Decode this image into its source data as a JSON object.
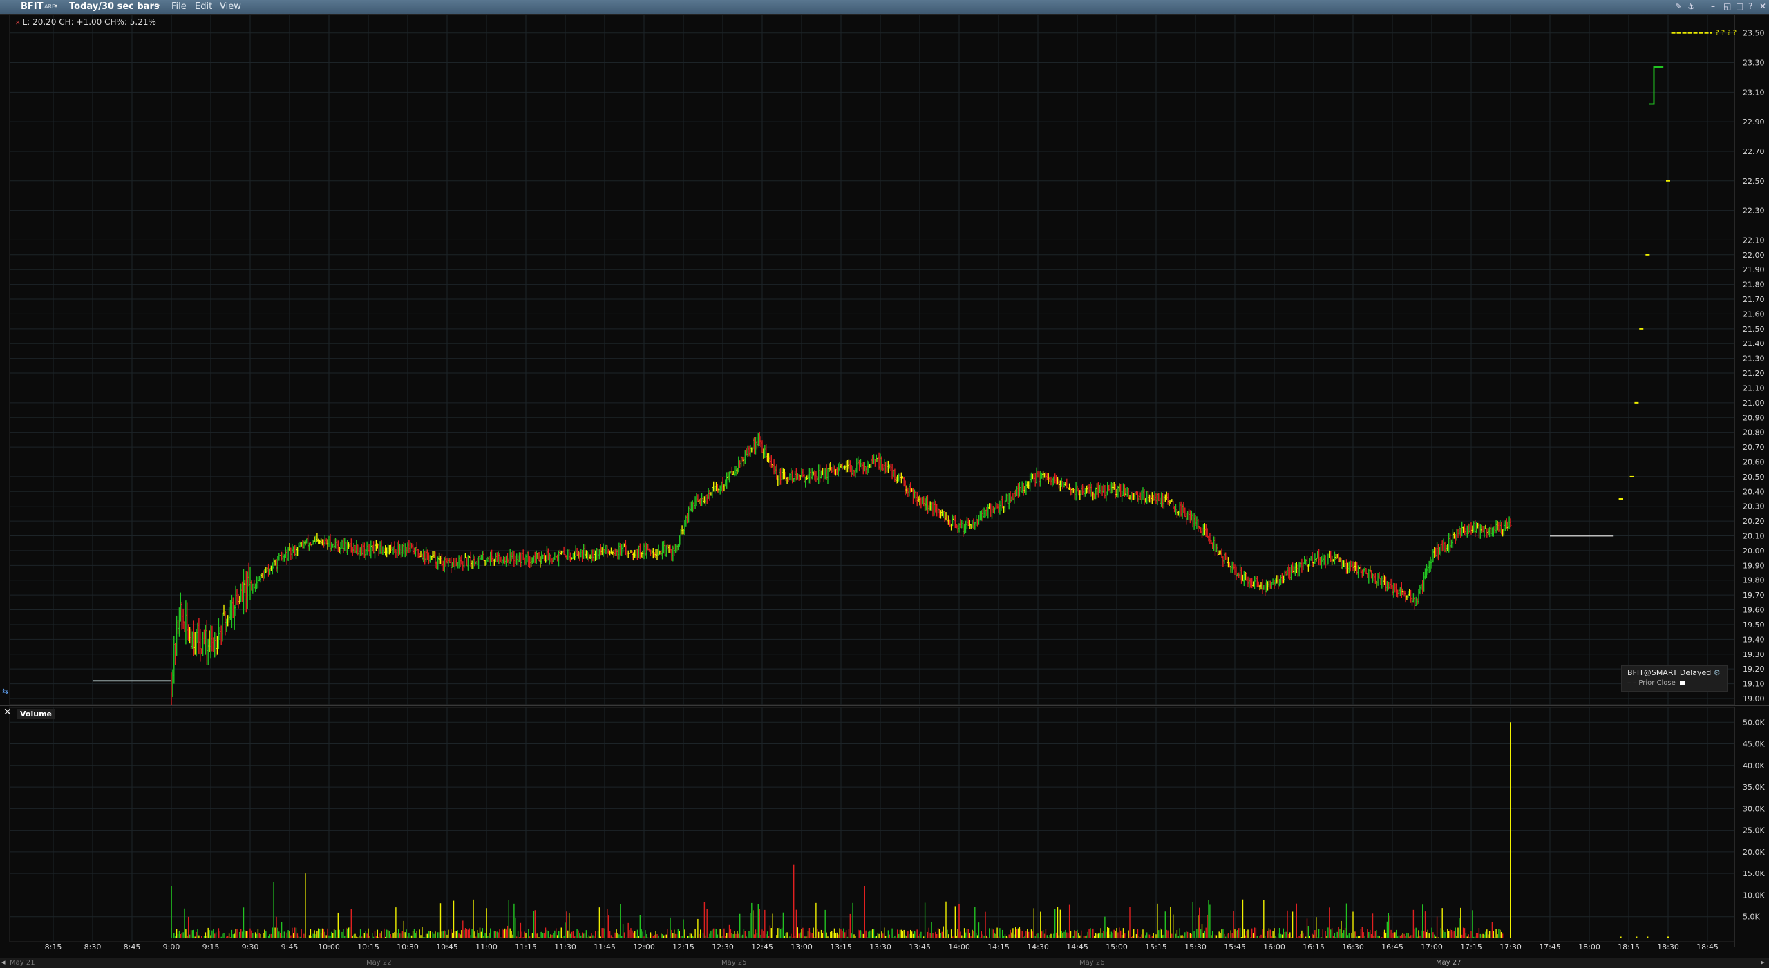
{
  "titlebar": {
    "symbol": "BFIT",
    "exchange": "ARB",
    "period": "Today/30 sec bars",
    "menu": [
      "File",
      "Edit",
      "View"
    ]
  },
  "price_pane": {
    "info": "L: 20.20 CH: +1.00 CH%: 5.21%",
    "legend_title": "BFIT@SMART Delayed",
    "legend_item": "Prior Close",
    "right_labels": "? ? ? ?"
  },
  "volume_pane": {
    "title": "Volume"
  },
  "time_axis": [
    "8:15",
    "8:30",
    "8:45",
    "9:00",
    "9:15",
    "9:30",
    "9:45",
    "10:00",
    "10:15",
    "10:30",
    "10:45",
    "11:00",
    "11:15",
    "11:30",
    "11:45",
    "12:00",
    "12:15",
    "12:30",
    "12:45",
    "13:00",
    "13:15",
    "13:30",
    "13:45",
    "14:00",
    "14:15",
    "14:30",
    "14:45",
    "15:00",
    "15:15",
    "15:30",
    "15:45",
    "16:00",
    "16:15",
    "16:30",
    "16:45",
    "17:00",
    "17:15",
    "17:30",
    "17:45",
    "18:00",
    "18:15",
    "18:30",
    "18:45"
  ],
  "date_labels": [
    "May 21",
    "May 22",
    "May 25",
    "May 26",
    "May 27"
  ],
  "colors": {
    "up": "#22c322",
    "down": "#e02020",
    "flat": "#f0f000",
    "grid": "#1d2428",
    "axis_text": "#d8d8d8"
  },
  "chart_data": [
    {
      "type": "bar",
      "title": "",
      "ylim": [
        19.0,
        23.55
      ],
      "yticks": [
        "23.50",
        "23.30",
        "23.10",
        "22.90",
        "22.70",
        "22.50",
        "22.30",
        "22.10",
        "22.00",
        "21.90",
        "21.80",
        "21.70",
        "21.60",
        "21.50",
        "21.40",
        "21.30",
        "21.20",
        "21.10",
        "21.00",
        "20.90",
        "20.80",
        "20.70",
        "20.60",
        "20.50",
        "20.40",
        "20.30",
        "20.20",
        "20.10",
        "20.00",
        "19.90",
        "19.80",
        "19.70",
        "19.60",
        "19.50",
        "19.40",
        "19.30",
        "19.20",
        "19.10",
        "19.00"
      ],
      "prior_close": 19.2,
      "series": [
        {
          "values": [
            [
              8.5,
              19.12
            ],
            [
              8.75,
              19.12
            ],
            [
              9.0,
              19.12
            ],
            [
              9.05,
              19.6
            ],
            [
              9.1,
              19.45
            ],
            [
              9.25,
              19.35
            ],
            [
              9.4,
              19.65
            ],
            [
              9.55,
              19.8
            ],
            [
              9.7,
              19.95
            ],
            [
              9.85,
              20.05
            ],
            [
              10.0,
              20.05
            ],
            [
              10.25,
              20.0
            ],
            [
              10.5,
              20.02
            ],
            [
              10.75,
              19.9
            ],
            [
              11.0,
              19.95
            ],
            [
              11.25,
              19.95
            ],
            [
              11.5,
              19.97
            ],
            [
              11.75,
              20.0
            ],
            [
              12.0,
              20.0
            ],
            [
              12.2,
              20.0
            ],
            [
              12.3,
              20.3
            ],
            [
              12.5,
              20.45
            ],
            [
              12.72,
              20.75
            ],
            [
              12.85,
              20.5
            ],
            [
              13.0,
              20.5
            ],
            [
              13.3,
              20.55
            ],
            [
              13.5,
              20.6
            ],
            [
              13.75,
              20.35
            ],
            [
              14.0,
              20.15
            ],
            [
              14.25,
              20.3
            ],
            [
              14.5,
              20.5
            ],
            [
              14.75,
              20.4
            ],
            [
              15.0,
              20.4
            ],
            [
              15.3,
              20.35
            ],
            [
              15.5,
              20.2
            ],
            [
              15.75,
              19.85
            ],
            [
              15.95,
              19.75
            ],
            [
              16.25,
              19.95
            ],
            [
              16.5,
              19.9
            ],
            [
              16.75,
              19.75
            ],
            [
              16.9,
              19.65
            ],
            [
              17.0,
              19.95
            ],
            [
              17.2,
              20.15
            ],
            [
              17.4,
              20.15
            ],
            [
              17.5,
              20.18
            ]
          ]
        }
      ],
      "after_hours": [
        [
          17.7,
          20.1
        ],
        [
          18.1,
          20.1
        ],
        [
          18.2,
          20.35
        ],
        [
          18.27,
          20.5
        ],
        [
          18.3,
          21.0
        ],
        [
          18.33,
          21.5
        ],
        [
          18.37,
          22.0
        ],
        [
          18.42,
          23.05
        ],
        [
          18.5,
          23.25
        ],
        [
          18.7,
          23.5
        ],
        [
          18.9,
          23.5
        ],
        [
          18.5,
          22.5
        ]
      ]
    },
    {
      "type": "bar",
      "title": "Volume",
      "ylim": [
        0,
        51000
      ],
      "yticks": [
        "50.0K",
        "45.0K",
        "40.0K",
        "35.0K",
        "30.0K",
        "25.0K",
        "20.0K",
        "15.0K",
        "10.0K",
        "5.0K"
      ],
      "spike": {
        "x": 17.5,
        "value": 50000
      },
      "notable": [
        [
          9.0,
          12000
        ],
        [
          9.65,
          13000
        ],
        [
          9.85,
          15000
        ],
        [
          12.95,
          17000
        ],
        [
          13.4,
          12000
        ],
        [
          15.8,
          9000
        ],
        [
          11.0,
          7000
        ],
        [
          14.0,
          8000
        ]
      ]
    }
  ]
}
